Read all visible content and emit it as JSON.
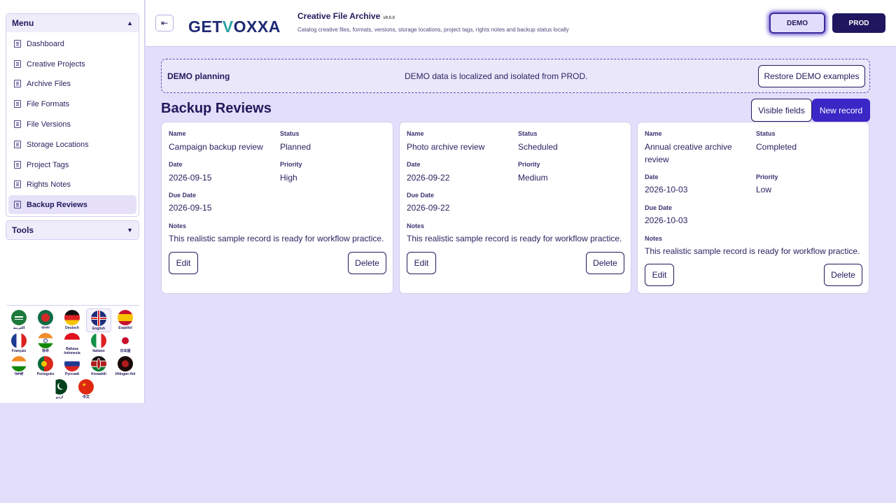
{
  "sidebar": {
    "menu_title": "Menu",
    "items": [
      {
        "label": "Dashboard",
        "active": false
      },
      {
        "label": "Creative Projects",
        "active": false
      },
      {
        "label": "Archive Files",
        "active": false
      },
      {
        "label": "File Formats",
        "active": false
      },
      {
        "label": "File Versions",
        "active": false
      },
      {
        "label": "Storage Locations",
        "active": false
      },
      {
        "label": "Project Tags",
        "active": false
      },
      {
        "label": "Rights Notes",
        "active": false
      },
      {
        "label": "Backup Reviews",
        "active": true
      }
    ],
    "tools_title": "Tools"
  },
  "languages": [
    {
      "label": "العربية",
      "flag": "saudi-arabia"
    },
    {
      "label": "বাংলা",
      "flag": "bangladesh"
    },
    {
      "label": "Deutsch",
      "flag": "germany"
    },
    {
      "label": "English",
      "flag": "united-kingdom",
      "selected": true
    },
    {
      "label": "Español",
      "flag": "spain"
    },
    {
      "label": "Français",
      "flag": "france"
    },
    {
      "label": "हिन्दी",
      "flag": "india"
    },
    {
      "label": "Bahasa Indonesia",
      "flag": "indonesia"
    },
    {
      "label": "Italiano",
      "flag": "italy"
    },
    {
      "label": "日本語",
      "flag": "japan"
    },
    {
      "label": "ਪੰਜਾਬੀ",
      "flag": "india"
    },
    {
      "label": "Português",
      "flag": "portugal"
    },
    {
      "label": "Русский",
      "flag": "russia"
    },
    {
      "label": "Kiswahili",
      "flag": "kenya"
    },
    {
      "label": "tlhIngan Hol",
      "flag": "klingon"
    },
    {
      "label": "اردو",
      "flag": "pakistan"
    },
    {
      "label": "中文",
      "flag": "china"
    }
  ],
  "header": {
    "logo_left": "GET",
    "logo_v": "V",
    "logo_right": "OXXA",
    "app_title": "Creative File Archive",
    "version": "v9.0.0",
    "subtitle": "Catalog creative files, formats, versions, storage locations, project tags, rights notes and backup status locally",
    "env_demo": "DEMO",
    "env_prod": "PROD"
  },
  "banner": {
    "title": "DEMO planning",
    "message": "DEMO data is localized and isolated from PROD.",
    "restore_label": "Restore DEMO examples"
  },
  "page": {
    "title": "Backup Reviews",
    "visible_fields_label": "Visible fields",
    "new_record_label": "New record"
  },
  "labels": {
    "name": "Name",
    "status": "Status",
    "date": "Date",
    "priority": "Priority",
    "due_date": "Due Date",
    "notes": "Notes",
    "edit": "Edit",
    "delete": "Delete"
  },
  "records": [
    {
      "name": "Campaign backup review",
      "status": "Planned",
      "date": "2026-09-15",
      "priority": "High",
      "due_date": "2026-09-15",
      "notes": "This realistic sample record is ready for workflow practice."
    },
    {
      "name": "Photo archive review",
      "status": "Scheduled",
      "date": "2026-09-22",
      "priority": "Medium",
      "due_date": "2026-09-22",
      "notes": "This realistic sample record is ready for workflow practice."
    },
    {
      "name": "Annual creative archive review",
      "status": "Completed",
      "date": "2026-10-03",
      "priority": "Low",
      "due_date": "2026-10-03",
      "notes": "This realistic sample record is ready for workflow practice."
    }
  ],
  "colors": {
    "accent": "#3b26c6",
    "navy": "#22195c",
    "background": "#e3defa"
  }
}
